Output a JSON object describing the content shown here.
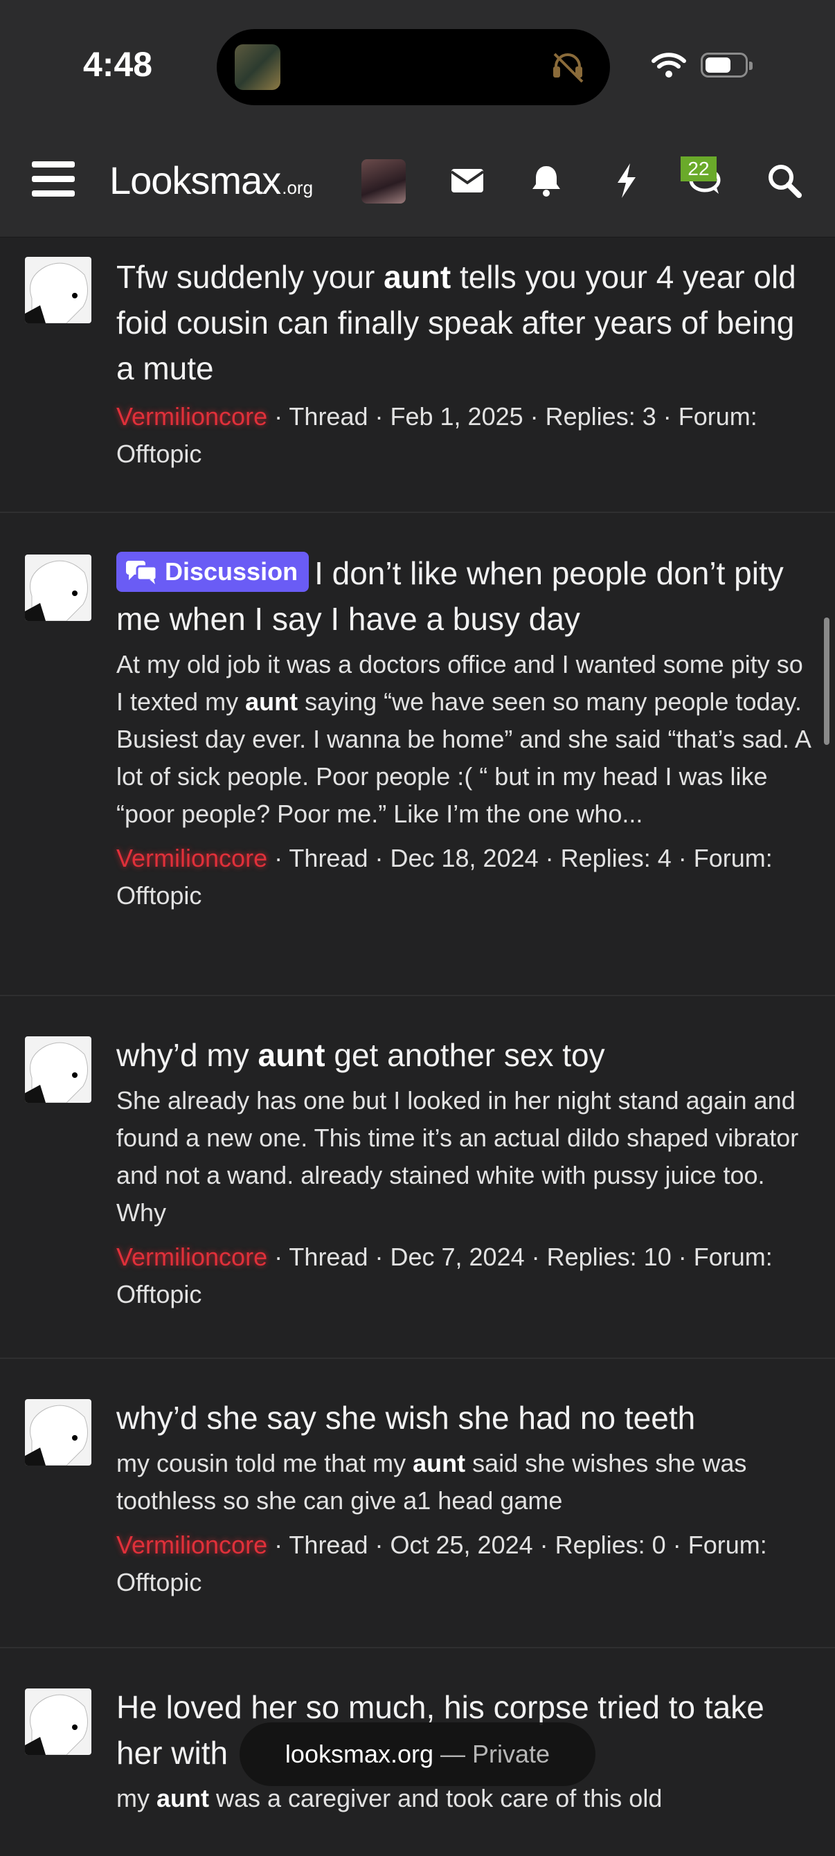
{
  "status_bar": {
    "time": "4:48"
  },
  "header": {
    "logo_text": "Looksmax",
    "logo_tld": ".org",
    "notification_count": "22"
  },
  "results": [
    {
      "title_pre": "Tfw suddenly your ",
      "title_bold": "aunt",
      "title_post": " tells you your 4 year old foid cousin can finally speak after years of being a mute",
      "author": "Vermilioncore",
      "meta": " · Thread · Feb 1, 2025 · Replies: 3 · Forum: Offtopic"
    },
    {
      "label": "Discussion",
      "title": "I don’t like when people don’t pity me when I say I have a busy day",
      "snippet_pre": "At my old job it was a doctors office and I wanted some pity so I texted my ",
      "snippet_bold": "aunt",
      "snippet_post": " saying “we have seen so many people today. Busiest day ever. I wanna be home” and she said “that’s sad. A lot of sick people. Poor people :( “ but in my head I was like “poor people? Poor me.” Like I’m the one who...",
      "author": "Vermilioncore",
      "meta": " · Thread · Dec 18, 2024 · Replies: 4 · Forum: Offtopic"
    },
    {
      "title_pre": "why’d my ",
      "title_bold": "aunt",
      "title_post": " get another sex toy",
      "snippet": "She already has one but I looked in her night stand again and found a new one. This time it’s an actual dildo shaped vibrator and not a wand. already stained white with pussy juice too. Why",
      "author": "Vermilioncore",
      "meta": " · Thread · Dec 7, 2024 · Replies: 10 · Forum: Offtopic"
    },
    {
      "title": "why’d she say she wish she had no teeth",
      "snippet_pre": "my cousin told me that my ",
      "snippet_bold": "aunt",
      "snippet_post": " said she wishes she was toothless so she can give a1 head game",
      "author": "Vermilioncore",
      "meta": " · Thread · Oct 25, 2024 · Replies: 0 · Forum: Offtopic"
    },
    {
      "title": "He loved her so much, his corpse tried to take her with",
      "snippet_pre": "my ",
      "snippet_bold": "aunt",
      "snippet_post": " was a caregiver and took care of this old"
    }
  ],
  "url_bar": {
    "domain": "looksmax.org",
    "mode": " — Private"
  },
  "colors": {
    "background": "#222223",
    "header": "#2c2c2d",
    "author": "#e0303a",
    "label": "#6a5cf5",
    "badge": "#6aaa2a"
  }
}
